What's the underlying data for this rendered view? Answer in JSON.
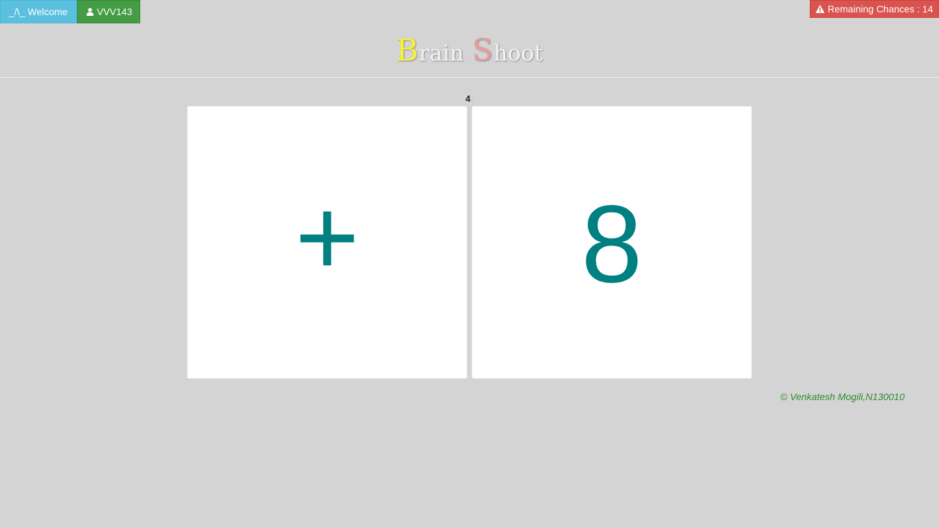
{
  "topbar": {
    "welcome_label": "_/\\_ Welcome",
    "user_label": "VVV143",
    "user_icon": "user-icon"
  },
  "alert": {
    "icon": "warning-icon",
    "label": "Remaining Chances : 14"
  },
  "brand": {
    "word1_cap": "B",
    "word1_rest": "rain",
    "word2_cap": "S",
    "word2_rest": "hoot",
    "colors": {
      "cap1": "#ffff33",
      "cap2": "#e89aa0"
    }
  },
  "question": {
    "number": "4",
    "suffix": "."
  },
  "cards": [
    {
      "value": "+"
    },
    {
      "value": "8"
    }
  ],
  "footer": {
    "text": "© Venkatesh Mogili,N130010"
  },
  "colors": {
    "background": "#d4d4d4",
    "accent": "#008080",
    "welcome": "#5bc0de",
    "user": "#449d44",
    "danger": "#d9534f"
  }
}
